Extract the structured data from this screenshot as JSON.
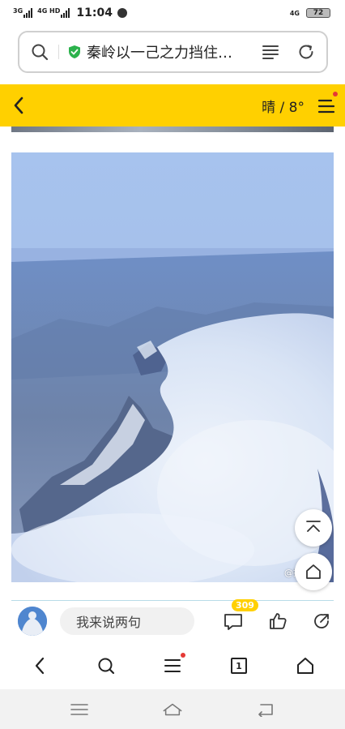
{
  "status_bar": {
    "sig1_label": "3G",
    "sig2_label": "4G HD",
    "time": "11:04",
    "net_label": "4G",
    "battery": "72"
  },
  "url_bar": {
    "title": "秦岭以一己之力挡住…"
  },
  "header": {
    "weather": "晴 / 8°",
    "accent_color": "#ffd000"
  },
  "article": {
    "watermark": "@托马斯的"
  },
  "comment_bar": {
    "placeholder": "我来说两句",
    "comment_count": "309"
  },
  "browser_nav": {
    "tab_count": "1"
  },
  "icons": [
    "search-icon",
    "shield-icon",
    "reader-icon",
    "refresh-icon",
    "back-icon",
    "menu-icon",
    "scroll-top-icon",
    "home-icon",
    "comment-icon",
    "like-icon",
    "share-icon",
    "tabs-icon"
  ]
}
